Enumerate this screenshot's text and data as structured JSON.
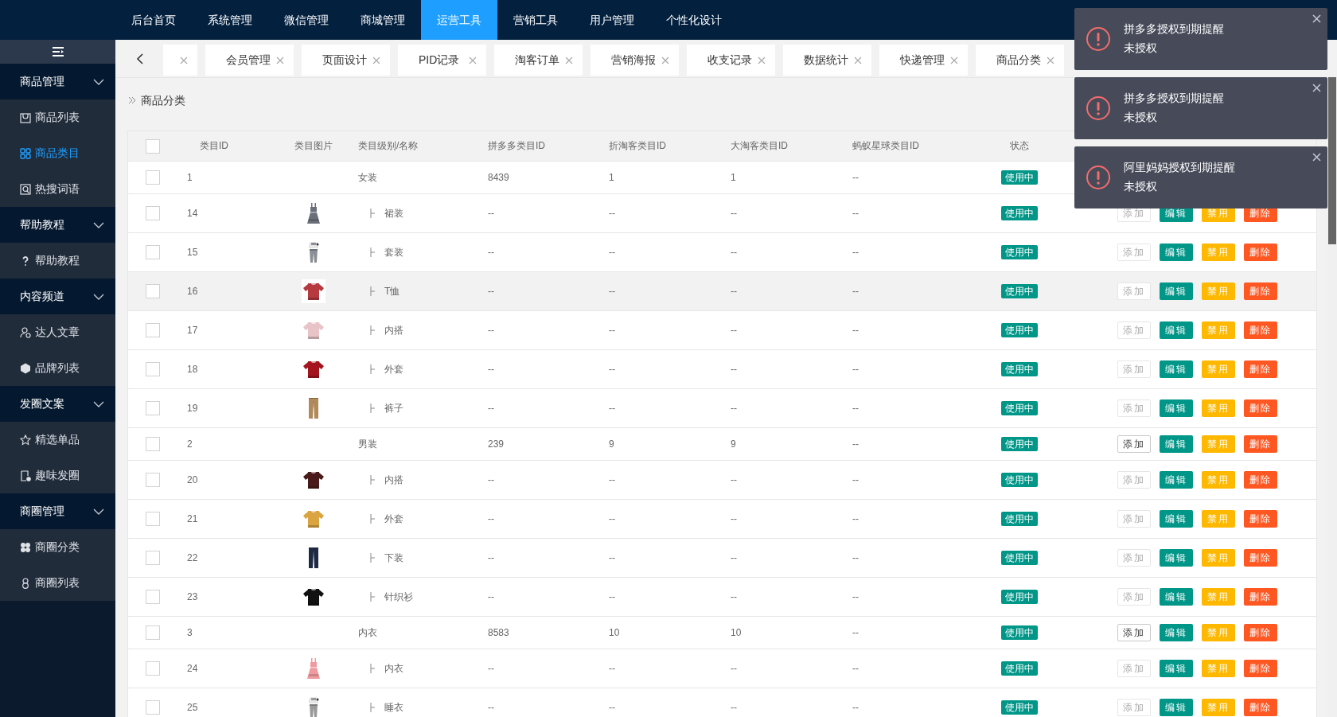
{
  "topnav": [
    {
      "label": "后台首页",
      "selected": false
    },
    {
      "label": "系统管理",
      "selected": false
    },
    {
      "label": "微信管理",
      "selected": false
    },
    {
      "label": "商城管理",
      "selected": false
    },
    {
      "label": "运营工具",
      "selected": true
    },
    {
      "label": "营销工具",
      "selected": false
    },
    {
      "label": "用户管理",
      "selected": false
    },
    {
      "label": "个性化设计",
      "selected": false
    }
  ],
  "sidebar": {
    "groups": [
      {
        "label": "商品管理",
        "expanded": true,
        "items": [
          {
            "label": "商品列表",
            "selected": false
          },
          {
            "label": "商品类目",
            "selected": true
          },
          {
            "label": "热搜词语",
            "selected": false
          }
        ]
      },
      {
        "label": "帮助教程",
        "expanded": true,
        "items": [
          {
            "label": "帮助教程",
            "selected": false
          }
        ]
      },
      {
        "label": "内容频道",
        "expanded": true,
        "items": [
          {
            "label": "达人文章",
            "selected": false
          },
          {
            "label": "品牌列表",
            "selected": false
          }
        ]
      },
      {
        "label": "发圈文案",
        "expanded": true,
        "items": [
          {
            "label": "精选单品",
            "selected": false
          },
          {
            "label": "趣味发圈",
            "selected": false
          }
        ]
      },
      {
        "label": "商圈管理",
        "expanded": true,
        "items": [
          {
            "label": "商圈分类",
            "selected": false
          },
          {
            "label": "商圈列表",
            "selected": false
          }
        ]
      }
    ]
  },
  "tabs": [
    {
      "kind": "clipped"
    },
    {
      "kind": "tab",
      "label": "会员管理"
    },
    {
      "kind": "tab",
      "label": "页面设计"
    },
    {
      "kind": "tab",
      "label": "PID记录"
    },
    {
      "kind": "tab",
      "label": "淘客订单"
    },
    {
      "kind": "tab",
      "label": "营销海报"
    },
    {
      "kind": "tab",
      "label": "收支记录"
    },
    {
      "kind": "tab",
      "label": "数据统计"
    },
    {
      "kind": "tab",
      "label": "快递管理"
    },
    {
      "kind": "tab",
      "label": "商品分类"
    }
  ],
  "breadcrumb": "商品分类",
  "table": {
    "header_checked": false,
    "columns": [
      "类目ID",
      "类目图片",
      "类目级别/名称",
      "拼多多类目ID",
      "折淘客类目ID",
      "大淘客类目ID",
      "蚂蚁星球类目ID",
      "状态"
    ],
    "rows": [
      {
        "id": "1",
        "name": "女装",
        "pdd_id": "8439",
        "zhe_id": "1",
        "da_id": "1",
        "ant_id": "--",
        "status": "使用中",
        "checked": false,
        "hovered": false,
        "children": [
          {
            "id": "14",
            "image": {
              "kind": "picture"
            },
            "name": "裙装",
            "pdd_id": "--",
            "zhe_id": "--",
            "da_id": "--",
            "ant_id": "--",
            "status": "使用中",
            "checked": false,
            "hovered": false,
            "actions": [
              {
                "kind": "add",
                "label": "添加",
                "disabled": true
              },
              {
                "kind": "edit",
                "label": "编辑",
                "disabled": false
              },
              {
                "kind": "ban",
                "label": "禁用",
                "disabled": false
              },
              {
                "kind": "delete",
                "label": "删除",
                "disabled": false
              }
            ]
          },
          {
            "id": "15",
            "image": {
              "kind": "picture"
            },
            "name": "套装",
            "pdd_id": "--",
            "zhe_id": "--",
            "da_id": "--",
            "ant_id": "--",
            "status": "使用中",
            "checked": false,
            "hovered": false,
            "actions": [
              {
                "kind": "add",
                "label": "添加",
                "disabled": true
              },
              {
                "kind": "edit",
                "label": "编辑",
                "disabled": false
              },
              {
                "kind": "ban",
                "label": "禁用",
                "disabled": false
              },
              {
                "kind": "delete",
                "label": "删除",
                "disabled": false
              }
            ]
          },
          {
            "id": "16",
            "image": {
              "kind": "picture"
            },
            "name": "T恤",
            "pdd_id": "--",
            "zhe_id": "--",
            "da_id": "--",
            "ant_id": "--",
            "status": "使用中",
            "checked": false,
            "hovered": true,
            "actions": [
              {
                "kind": "add",
                "label": "添加",
                "disabled": true
              },
              {
                "kind": "edit",
                "label": "编辑",
                "disabled": false
              },
              {
                "kind": "ban",
                "label": "禁用",
                "disabled": false
              },
              {
                "kind": "delete",
                "label": "删除",
                "disabled": false
              }
            ]
          },
          {
            "id": "17",
            "image": {
              "kind": "picture"
            },
            "name": "内搭",
            "pdd_id": "--",
            "zhe_id": "--",
            "da_id": "--",
            "ant_id": "--",
            "status": "使用中",
            "checked": false,
            "hovered": false,
            "actions": [
              {
                "kind": "add",
                "label": "添加",
                "disabled": true
              },
              {
                "kind": "edit",
                "label": "编辑",
                "disabled": false
              },
              {
                "kind": "ban",
                "label": "禁用",
                "disabled": false
              },
              {
                "kind": "delete",
                "label": "删除",
                "disabled": false
              }
            ]
          },
          {
            "id": "18",
            "image": {
              "kind": "picture"
            },
            "name": "外套",
            "pdd_id": "--",
            "zhe_id": "--",
            "da_id": "--",
            "ant_id": "--",
            "status": "使用中",
            "checked": false,
            "hovered": false,
            "actions": [
              {
                "kind": "add",
                "label": "添加",
                "disabled": true
              },
              {
                "kind": "edit",
                "label": "编辑",
                "disabled": false
              },
              {
                "kind": "ban",
                "label": "禁用",
                "disabled": false
              },
              {
                "kind": "delete",
                "label": "删除",
                "disabled": false
              }
            ]
          },
          {
            "id": "19",
            "image": {
              "kind": "picture"
            },
            "name": "裤子",
            "pdd_id": "--",
            "zhe_id": "--",
            "da_id": "--",
            "ant_id": "--",
            "status": "使用中",
            "checked": false,
            "hovered": false,
            "actions": [
              {
                "kind": "add",
                "label": "添加",
                "disabled": true
              },
              {
                "kind": "edit",
                "label": "编辑",
                "disabled": false
              },
              {
                "kind": "ban",
                "label": "禁用",
                "disabled": false
              },
              {
                "kind": "delete",
                "label": "删除",
                "disabled": false
              }
            ]
          }
        ]
      },
      {
        "id": "2",
        "name": "男装",
        "pdd_id": "239",
        "zhe_id": "9",
        "da_id": "9",
        "ant_id": "--",
        "status": "使用中",
        "checked": false,
        "hovered": false,
        "actions": [
          {
            "kind": "add",
            "label": "添加",
            "disabled": false
          },
          {
            "kind": "edit",
            "label": "编辑",
            "disabled": false
          },
          {
            "kind": "ban",
            "label": "禁用",
            "disabled": false
          },
          {
            "kind": "delete",
            "label": "删除",
            "disabled": false
          }
        ],
        "children": [
          {
            "id": "20",
            "image": {
              "kind": "picture"
            },
            "name": "内搭",
            "pdd_id": "--",
            "zhe_id": "--",
            "da_id": "--",
            "ant_id": "--",
            "status": "使用中",
            "checked": false,
            "hovered": false,
            "actions": [
              {
                "kind": "add",
                "label": "添加",
                "disabled": true
              },
              {
                "kind": "edit",
                "label": "编辑",
                "disabled": false
              },
              {
                "kind": "ban",
                "label": "禁用",
                "disabled": false
              },
              {
                "kind": "delete",
                "label": "删除",
                "disabled": false
              }
            ]
          },
          {
            "id": "21",
            "image": {
              "kind": "picture"
            },
            "name": "外套",
            "pdd_id": "--",
            "zhe_id": "--",
            "da_id": "--",
            "ant_id": "--",
            "status": "使用中",
            "checked": false,
            "hovered": false,
            "actions": [
              {
                "kind": "add",
                "label": "添加",
                "disabled": true
              },
              {
                "kind": "edit",
                "label": "编辑",
                "disabled": false
              },
              {
                "kind": "ban",
                "label": "禁用",
                "disabled": false
              },
              {
                "kind": "delete",
                "label": "删除",
                "disabled": false
              }
            ]
          },
          {
            "id": "22",
            "image": {
              "kind": "picture"
            },
            "name": "下装",
            "pdd_id": "--",
            "zhe_id": "--",
            "da_id": "--",
            "ant_id": "--",
            "status": "使用中",
            "checked": false,
            "hovered": false,
            "actions": [
              {
                "kind": "add",
                "label": "添加",
                "disabled": true
              },
              {
                "kind": "edit",
                "label": "编辑",
                "disabled": false
              },
              {
                "kind": "ban",
                "label": "禁用",
                "disabled": false
              },
              {
                "kind": "delete",
                "label": "删除",
                "disabled": false
              }
            ]
          },
          {
            "id": "23",
            "image": {
              "kind": "picture"
            },
            "name": "针织衫",
            "pdd_id": "--",
            "zhe_id": "--",
            "da_id": "--",
            "ant_id": "--",
            "status": "使用中",
            "checked": false,
            "hovered": false,
            "actions": [
              {
                "kind": "add",
                "label": "添加",
                "disabled": true
              },
              {
                "kind": "edit",
                "label": "编辑",
                "disabled": false
              },
              {
                "kind": "ban",
                "label": "禁用",
                "disabled": false
              },
              {
                "kind": "delete",
                "label": "删除",
                "disabled": false
              }
            ]
          }
        ]
      },
      {
        "id": "3",
        "name": "内衣",
        "pdd_id": "8583",
        "zhe_id": "10",
        "da_id": "10",
        "ant_id": "--",
        "status": "使用中",
        "checked": false,
        "hovered": false,
        "actions": [
          {
            "kind": "add",
            "label": "添加",
            "disabled": false
          },
          {
            "kind": "edit",
            "label": "编辑",
            "disabled": false
          },
          {
            "kind": "ban",
            "label": "禁用",
            "disabled": false
          },
          {
            "kind": "delete",
            "label": "删除",
            "disabled": false
          }
        ],
        "children": [
          {
            "id": "24",
            "image": {
              "kind": "picture"
            },
            "name": "内衣",
            "pdd_id": "--",
            "zhe_id": "--",
            "da_id": "--",
            "ant_id": "--",
            "status": "使用中",
            "checked": false,
            "hovered": false,
            "actions": [
              {
                "kind": "add",
                "label": "添加",
                "disabled": true
              },
              {
                "kind": "edit",
                "label": "编辑",
                "disabled": false
              },
              {
                "kind": "ban",
                "label": "禁用",
                "disabled": false
              },
              {
                "kind": "delete",
                "label": "删除",
                "disabled": false
              }
            ]
          },
          {
            "id": "25",
            "image": {
              "kind": "picture"
            },
            "name": "睡衣",
            "pdd_id": "--",
            "zhe_id": "--",
            "da_id": "--",
            "ant_id": "--",
            "status": "使用中",
            "checked": false,
            "hovered": false,
            "actions": [
              {
                "kind": "add",
                "label": "添加",
                "disabled": true
              },
              {
                "kind": "edit",
                "label": "编辑",
                "disabled": false
              },
              {
                "kind": "ban",
                "label": "禁用",
                "disabled": false
              },
              {
                "kind": "delete",
                "label": "删除",
                "disabled": false
              }
            ]
          }
        ]
      }
    ]
  },
  "notifications": [
    {
      "title": "拼多多授权到期提醒",
      "message": "未授权"
    },
    {
      "title": "拼多多授权到期提醒",
      "message": "未授权"
    },
    {
      "title": "阿里妈妈授权到期提醒",
      "message": "未授权"
    }
  ]
}
